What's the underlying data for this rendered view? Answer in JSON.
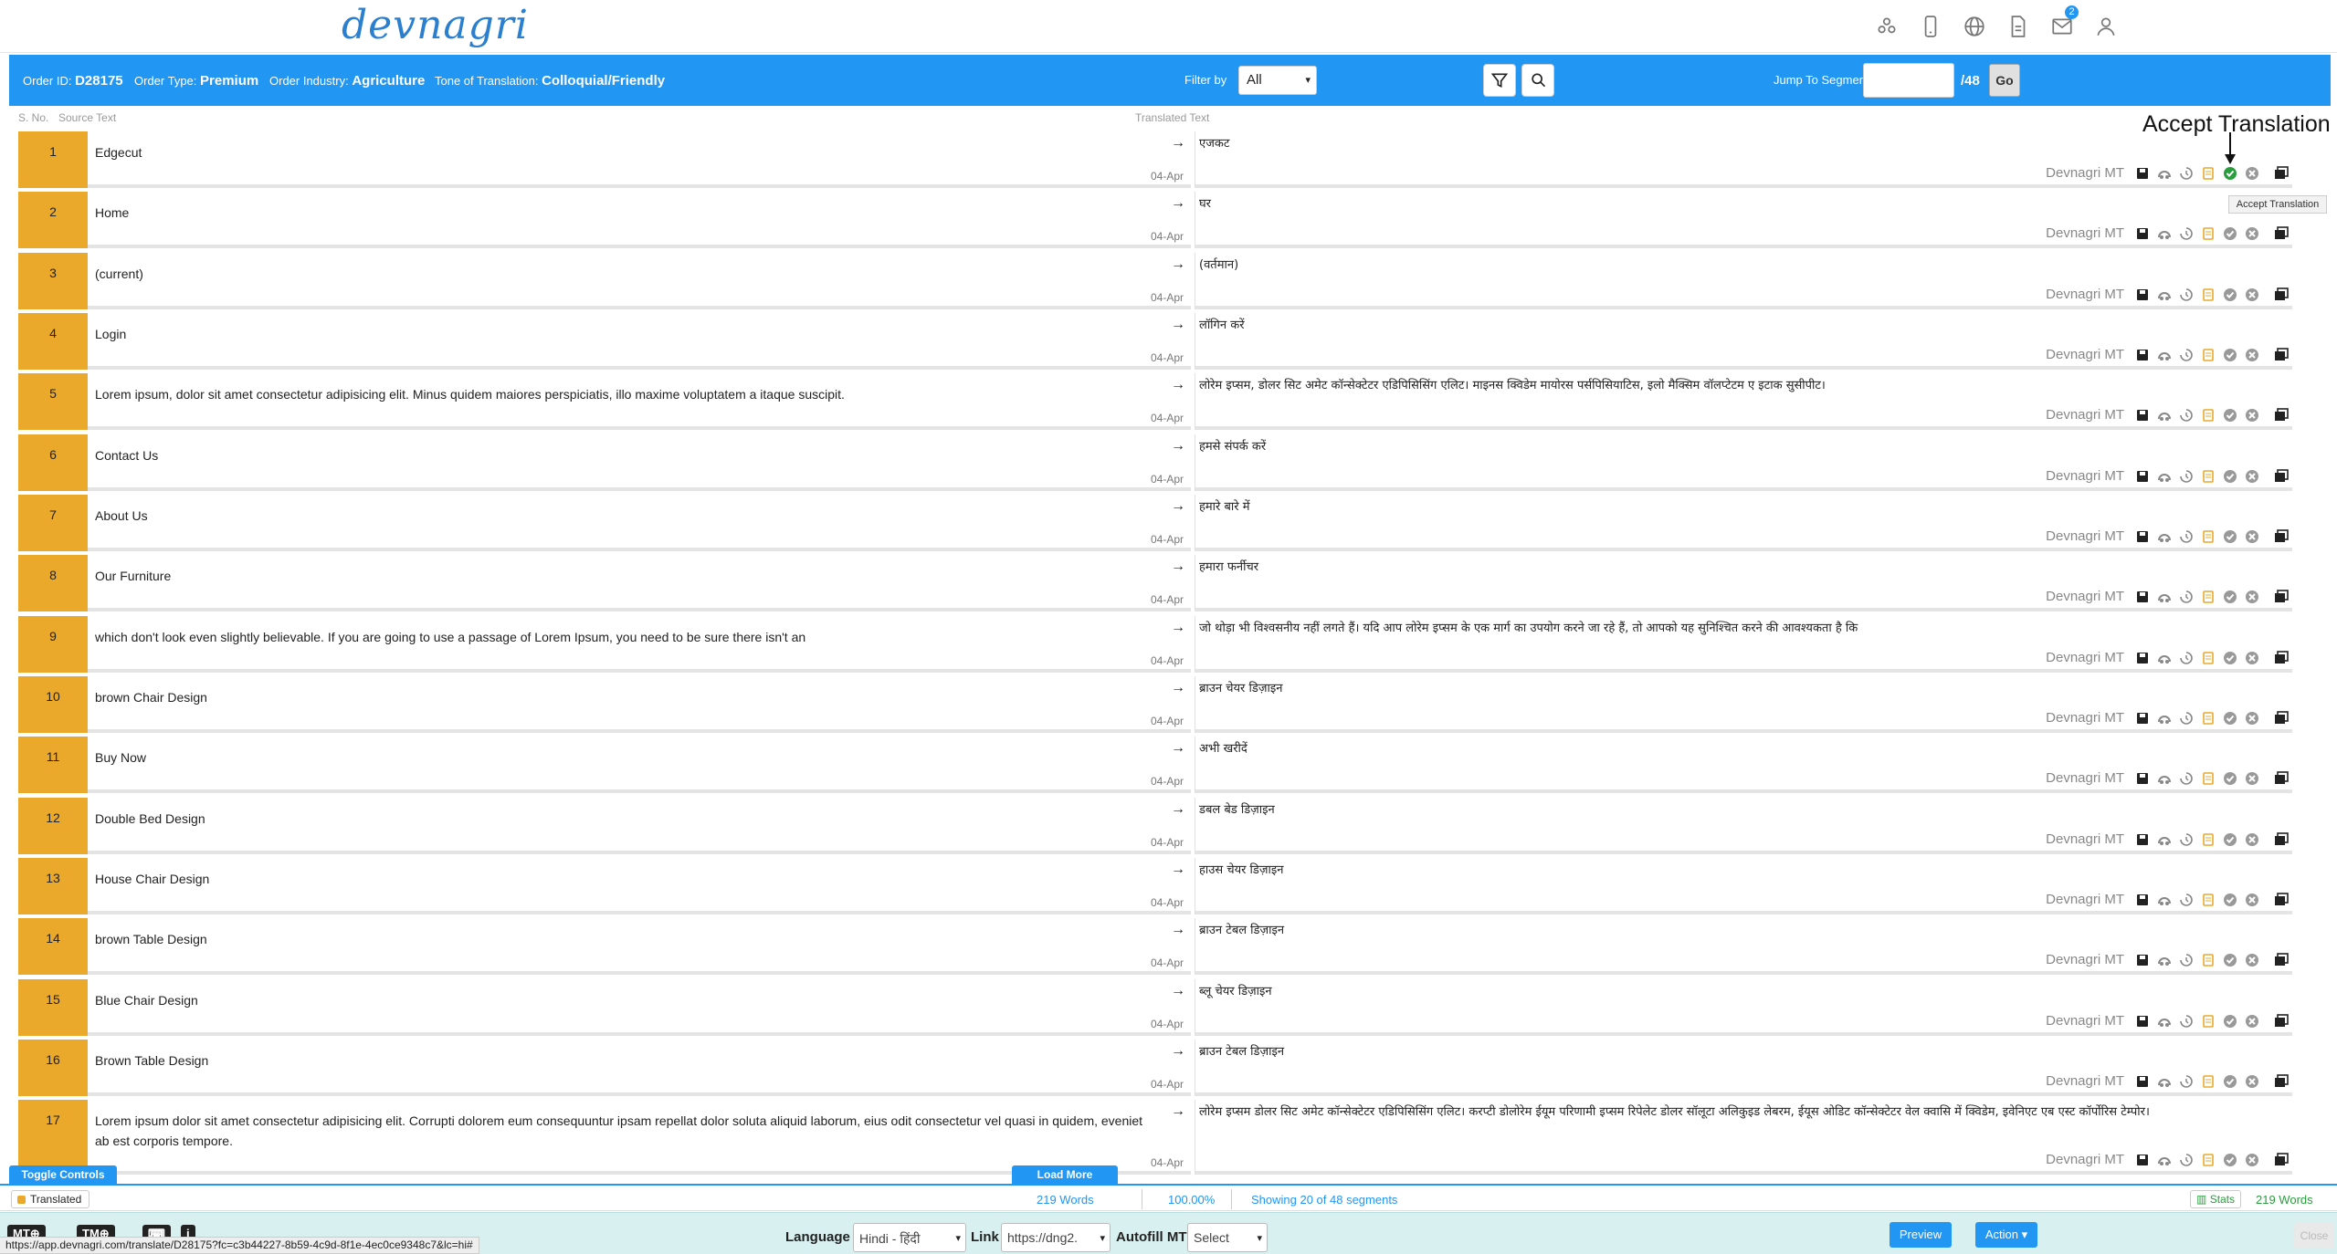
{
  "brand": {
    "logo": "devnagri"
  },
  "order": {
    "id_label": "Order ID:",
    "id": "D28175",
    "type_label": "Order Type:",
    "type": "Premium",
    "industry_label": "Order Industry:",
    "industry": "Agriculture",
    "tone_label": "Tone of Translation:",
    "tone": "Colloquial/Friendly"
  },
  "filter": {
    "label": "Filter by",
    "value": "All"
  },
  "jump": {
    "label": "Jump To Segment",
    "total": "/48",
    "go": "Go"
  },
  "columns": {
    "sno": "S. No.",
    "source": "Source Text",
    "translated": "Translated Text"
  },
  "notifications": {
    "count": "2"
  },
  "annotation": {
    "title": "Accept Translation",
    "tooltip": "Accept Translation"
  },
  "engine_label": "Devnagri MT",
  "segments": [
    {
      "num": "1",
      "source": "Edgecut",
      "target": "एजकट",
      "date": "04-Apr"
    },
    {
      "num": "2",
      "source": "Home",
      "target": "घर",
      "date": "04-Apr"
    },
    {
      "num": "3",
      "source": "(current)",
      "target": "(वर्तमान)",
      "date": "04-Apr"
    },
    {
      "num": "4",
      "source": "Login",
      "target": "लॉगिन करें",
      "date": "04-Apr"
    },
    {
      "num": "5",
      "source": "Lorem ipsum, dolor sit amet consectetur adipisicing elit. Minus quidem maiores perspiciatis, illo maxime voluptatem a itaque suscipit.",
      "target": "लोरेम इप्सम, डोलर सिट अमेट कॉन्सेक्टेटर एडिपिसिसिंग एलिट। माइनस क्विडेम मायोरस पर्सपिसियाटिस, इलो मैक्सिम वॉलप्टेटम ए इटाक सुसीपीट।",
      "date": "04-Apr"
    },
    {
      "num": "6",
      "source": "Contact Us",
      "target": "हमसे संपर्क करें",
      "date": "04-Apr"
    },
    {
      "num": "7",
      "source": "About Us",
      "target": "हमारे बारे में",
      "date": "04-Apr"
    },
    {
      "num": "8",
      "source": "Our Furniture",
      "target": "हमारा फर्नीचर",
      "date": "04-Apr"
    },
    {
      "num": "9",
      "source": "which don't look even slightly believable. If you are going to use a passage of Lorem Ipsum, you need to be sure there isn't an",
      "target": "जो थोड़ा भी विश्वसनीय नहीं लगते हैं। यदि आप लोरेम इप्सम के एक मार्ग का उपयोग करने जा रहे हैं, तो आपको यह सुनिश्चित करने की आवश्यकता है कि",
      "date": "04-Apr"
    },
    {
      "num": "10",
      "source": "brown Chair Design",
      "target": "ब्राउन चेयर डिज़ाइन",
      "date": "04-Apr"
    },
    {
      "num": "11",
      "source": "Buy Now",
      "target": "अभी खरीदें",
      "date": "04-Apr"
    },
    {
      "num": "12",
      "source": "Double Bed Design",
      "target": "डबल बेड डिज़ाइन",
      "date": "04-Apr"
    },
    {
      "num": "13",
      "source": "House Chair Design",
      "target": "हाउस चेयर डिज़ाइन",
      "date": "04-Apr"
    },
    {
      "num": "14",
      "source": "brown Table Design",
      "target": "ब्राउन टेबल डिज़ाइन",
      "date": "04-Apr"
    },
    {
      "num": "15",
      "source": "Blue Chair Design",
      "target": "ब्लू चेयर डिज़ाइन",
      "date": "04-Apr"
    },
    {
      "num": "16",
      "source": "Brown Table Design",
      "target": "ब्राउन टेबल डिज़ाइन",
      "date": "04-Apr"
    },
    {
      "num": "17",
      "source": "Lorem ipsum dolor sit amet consectetur adipisicing elit. Corrupti dolorem eum consequuntur ipsam repellat dolor soluta aliquid laborum, eius odit consectetur vel quasi in quidem, eveniet ab est corporis tempore.",
      "target": "लोरेम इप्सम डोलर सिट अमेट कॉन्सेक्टेटर एडिपिसिसिंग एलिट। करप्टी डोलोरेम ईयूम परिणामी इप्सम रिपेलेट डोलर सॉलूटा अलिकुइड लेबरम, ईयूस ओडिट कॉन्सेक्टेटर वेल क्वासि में क्विडेम, इवेनिएट एब एस्ट कॉर्पोरिस टेम्पोर।",
      "date": "04-Apr"
    }
  ],
  "controls": {
    "toggle": "Toggle Controls",
    "load_more": "Load More"
  },
  "status": {
    "legend": "Translated",
    "words": "219 Words",
    "percent": "100.00%",
    "showing": "Showing 20 of 48 segments",
    "stats": "Stats",
    "words_right": "219 Words"
  },
  "footer": {
    "mt_chip": "MT",
    "tm_chip": "TM",
    "url": "https://app.devnagri.com/translate/D28175?fc=c3b44227-8b59-4c9d-8f1e-4ec0ce9348c7&lc=hi#",
    "language_label": "Language",
    "language_value": "Hindi - हिंदी",
    "link_label": "Link",
    "link_value": "https://dng2.",
    "autofill_label": "Autofill MT",
    "autofill_value": "Select",
    "preview": "Preview",
    "action": "Action",
    "close": "Close"
  },
  "colors": {
    "primary": "#2196f3",
    "segment_num": "#eaa92b",
    "accept": "#2a9d3d"
  }
}
